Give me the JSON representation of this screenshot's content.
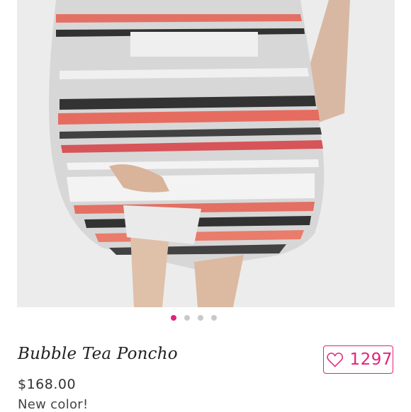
{
  "product": {
    "title": "Bubble Tea Poncho",
    "price": "$168.00",
    "note": "New color!"
  },
  "likes": {
    "count": "1297",
    "icon": "heart-icon"
  },
  "carousel": {
    "total": 4,
    "active_index": 0
  },
  "colors": {
    "accent": "#e3237c",
    "dot_inactive": "#c9c9c9"
  }
}
